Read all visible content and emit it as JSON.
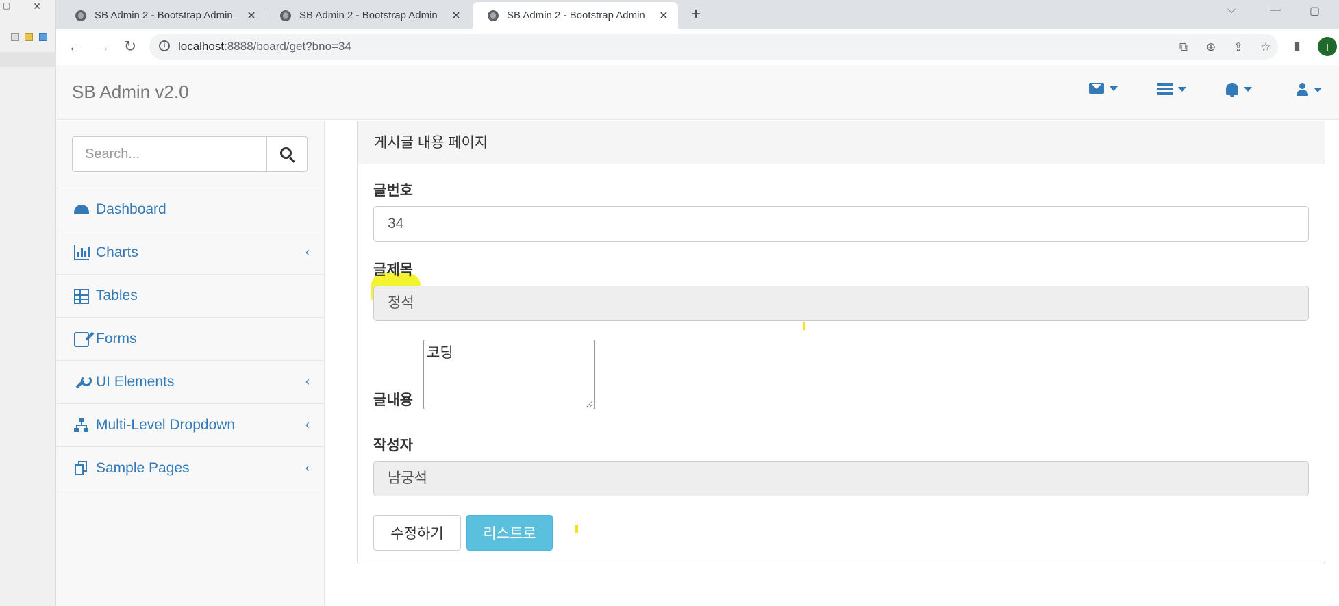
{
  "browser": {
    "tabs": [
      {
        "title": "SB Admin 2 - Bootstrap Admin",
        "active": false
      },
      {
        "title": "SB Admin 2 - Bootstrap Admin",
        "active": false
      },
      {
        "title": "SB Admin 2 - Bootstrap Admin",
        "active": true
      }
    ],
    "url_host": "localhost",
    "url_path": ":8888/board/get?bno=34",
    "profile_initial": "j"
  },
  "app": {
    "brand": "SB Admin v2.0",
    "search_placeholder": "Search...",
    "menu": [
      {
        "label": "Dashboard",
        "icon": "dashboard-icon",
        "has_children": false
      },
      {
        "label": "Charts",
        "icon": "bar-chart-icon",
        "has_children": true
      },
      {
        "label": "Tables",
        "icon": "table-icon",
        "has_children": false
      },
      {
        "label": "Forms",
        "icon": "edit-icon",
        "has_children": false
      },
      {
        "label": "UI Elements",
        "icon": "wrench-icon",
        "has_children": true
      },
      {
        "label": "Multi-Level Dropdown",
        "icon": "sitemap-icon",
        "has_children": true
      },
      {
        "label": "Sample Pages",
        "icon": "files-icon",
        "has_children": true
      }
    ]
  },
  "panel": {
    "heading": "게시글 내용 페이지",
    "bno_label": "글번호",
    "bno_value": "34",
    "title_label": "글제목",
    "title_value": "정석",
    "content_label": "글내용",
    "content_value": "코딩",
    "writer_label": "작성자",
    "writer_value": "남궁석",
    "modify_button": "수정하기",
    "list_button": "리스트로"
  },
  "colors": {
    "link": "#337ab7",
    "info_button": "#5bc0de",
    "highlight": "#f3f21a"
  }
}
